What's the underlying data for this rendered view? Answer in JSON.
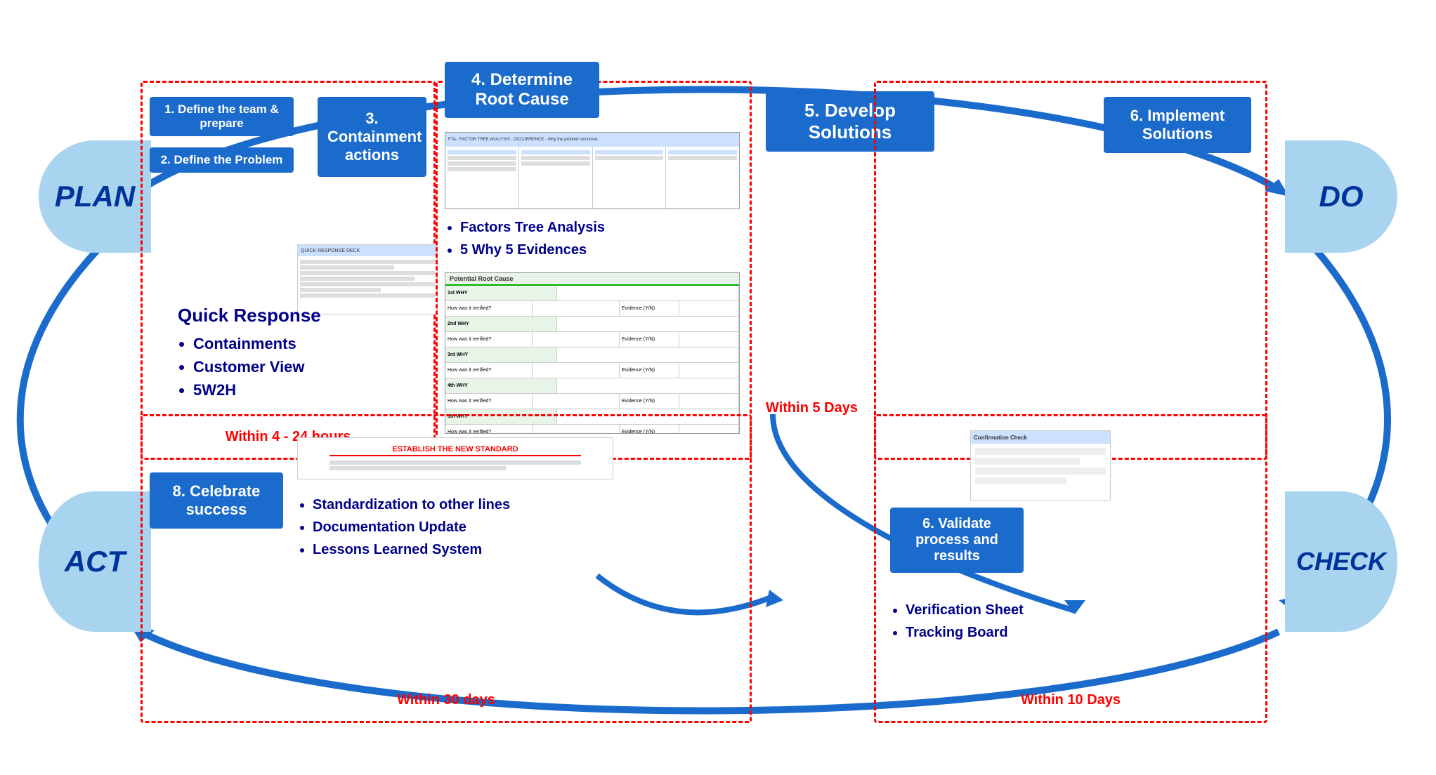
{
  "labels": {
    "plan": "PLAN",
    "do": "DO",
    "check": "CHECK",
    "act": "ACT"
  },
  "steps": {
    "step1": "1. Define the team & prepare",
    "step2": "2. Define the Problem",
    "step3": "3.\nContainment\nactions",
    "step3_label": "3. Containment actions",
    "step4": "4. Determine Root Cause",
    "step5": "5. Develop Solutions",
    "step6_top": "6. Implement Solutions",
    "step6_validate": "6. Validate process and results",
    "step8": "8. Celebrate success"
  },
  "bullets": {
    "root_cause": [
      "Factors Tree Analysis",
      "5 Why 5 Evidences"
    ],
    "quick_response_title": "Quick Response",
    "quick_response_items": [
      "Containments",
      "Customer View",
      "5W2H"
    ],
    "standardization_items": [
      "Standardization to other lines",
      "Documentation Update",
      "Lessons Learned System"
    ],
    "validate_items": [
      "Verification Sheet",
      "Tracking Board"
    ]
  },
  "timings": {
    "plan_timing": "Within 4 - 24 hours",
    "step5_timing": "Within 5 Days",
    "act_timing": "Within 30 days",
    "check_timing": "Within 10 Days"
  },
  "doc_labels": {
    "fta_header": "FTA - FACTOR TREE ANALYSIS - OCCURRENCE - Why the problem occurred.",
    "potential_root": "Potential Root Cause",
    "why1": "1st WHY",
    "why1_verified": "How was it verified?",
    "why1_evidence": "Evidence (Y/N)",
    "why2": "2nd WHY",
    "why2_verified": "How was it verified?",
    "why2_evidence": "Evidence (Y/N)",
    "why3": "3rd WHY",
    "why3_verified": "How was it verified?",
    "why3_evidence": "Evidence (Y/N)",
    "why4": "4th WHY",
    "why4_verified": "How was it verified?",
    "why4_evidence": "Evidence (Y/N)",
    "why5": "5th WHY",
    "why5_verified": "How was it verified?",
    "why5_evidence": "Evidence (Y/N)",
    "std_title": "ESTABLISH THE NEW STANDARD",
    "confirm_header": "Confirmation Check"
  },
  "colors": {
    "step_blue": "#1a6bcc",
    "dark_blue": "#00008B",
    "red": "#cc0000",
    "arrow_blue": "#1a6bcc",
    "light_blue_shape": "#a8d4f0"
  }
}
